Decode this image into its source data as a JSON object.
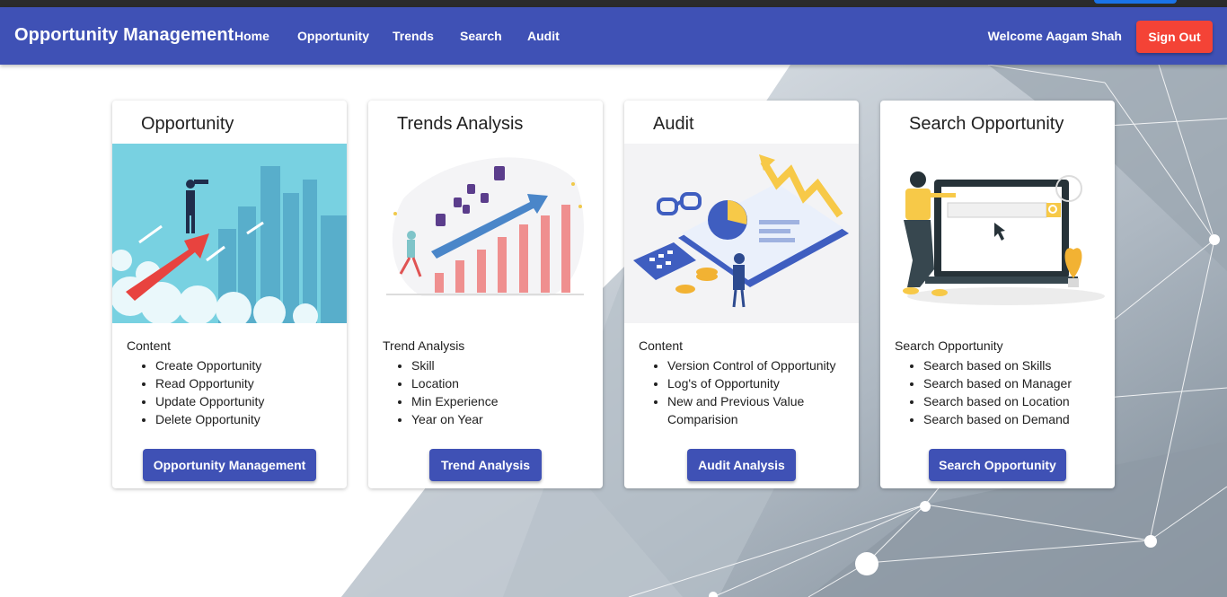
{
  "header": {
    "brand": "Opportunity Management",
    "nav": [
      "Home",
      "Opportunity",
      "Trends",
      "Search",
      "Audit"
    ],
    "welcome": "Welcome Aagam Shah",
    "signout_label": "Sign Out",
    "accent_color": "#3f51b5",
    "signout_color": "#f44336"
  },
  "cards": [
    {
      "title": "Opportunity",
      "subtitle": "Content",
      "items": [
        "Create Opportunity",
        "Read Opportunity",
        "Update Opportunity",
        "Delete Opportunity"
      ],
      "button": "Opportunity Management",
      "illustration": "businessman-on-arrow-illustration"
    },
    {
      "title": "Trends Analysis",
      "subtitle": "Trend Analysis",
      "items": [
        "Skill",
        "Location",
        "Min Experience",
        "Year on Year"
      ],
      "button": "Trend Analysis",
      "illustration": "growth-bar-chart-illustration"
    },
    {
      "title": "Audit",
      "subtitle": "Content",
      "items": [
        "Version Control of Opportunity",
        "Log's of Opportunity",
        "New and Previous Value Comparision"
      ],
      "button": "Audit Analysis",
      "illustration": "audit-dashboard-illustration"
    },
    {
      "title": "Search Opportunity",
      "subtitle": "Search Opportunity",
      "items": [
        "Search based on Skills",
        "Search based on Manager",
        "Search based on Location",
        "Search based on Demand"
      ],
      "button": "Search Opportunity",
      "illustration": "search-screen-illustration"
    }
  ]
}
